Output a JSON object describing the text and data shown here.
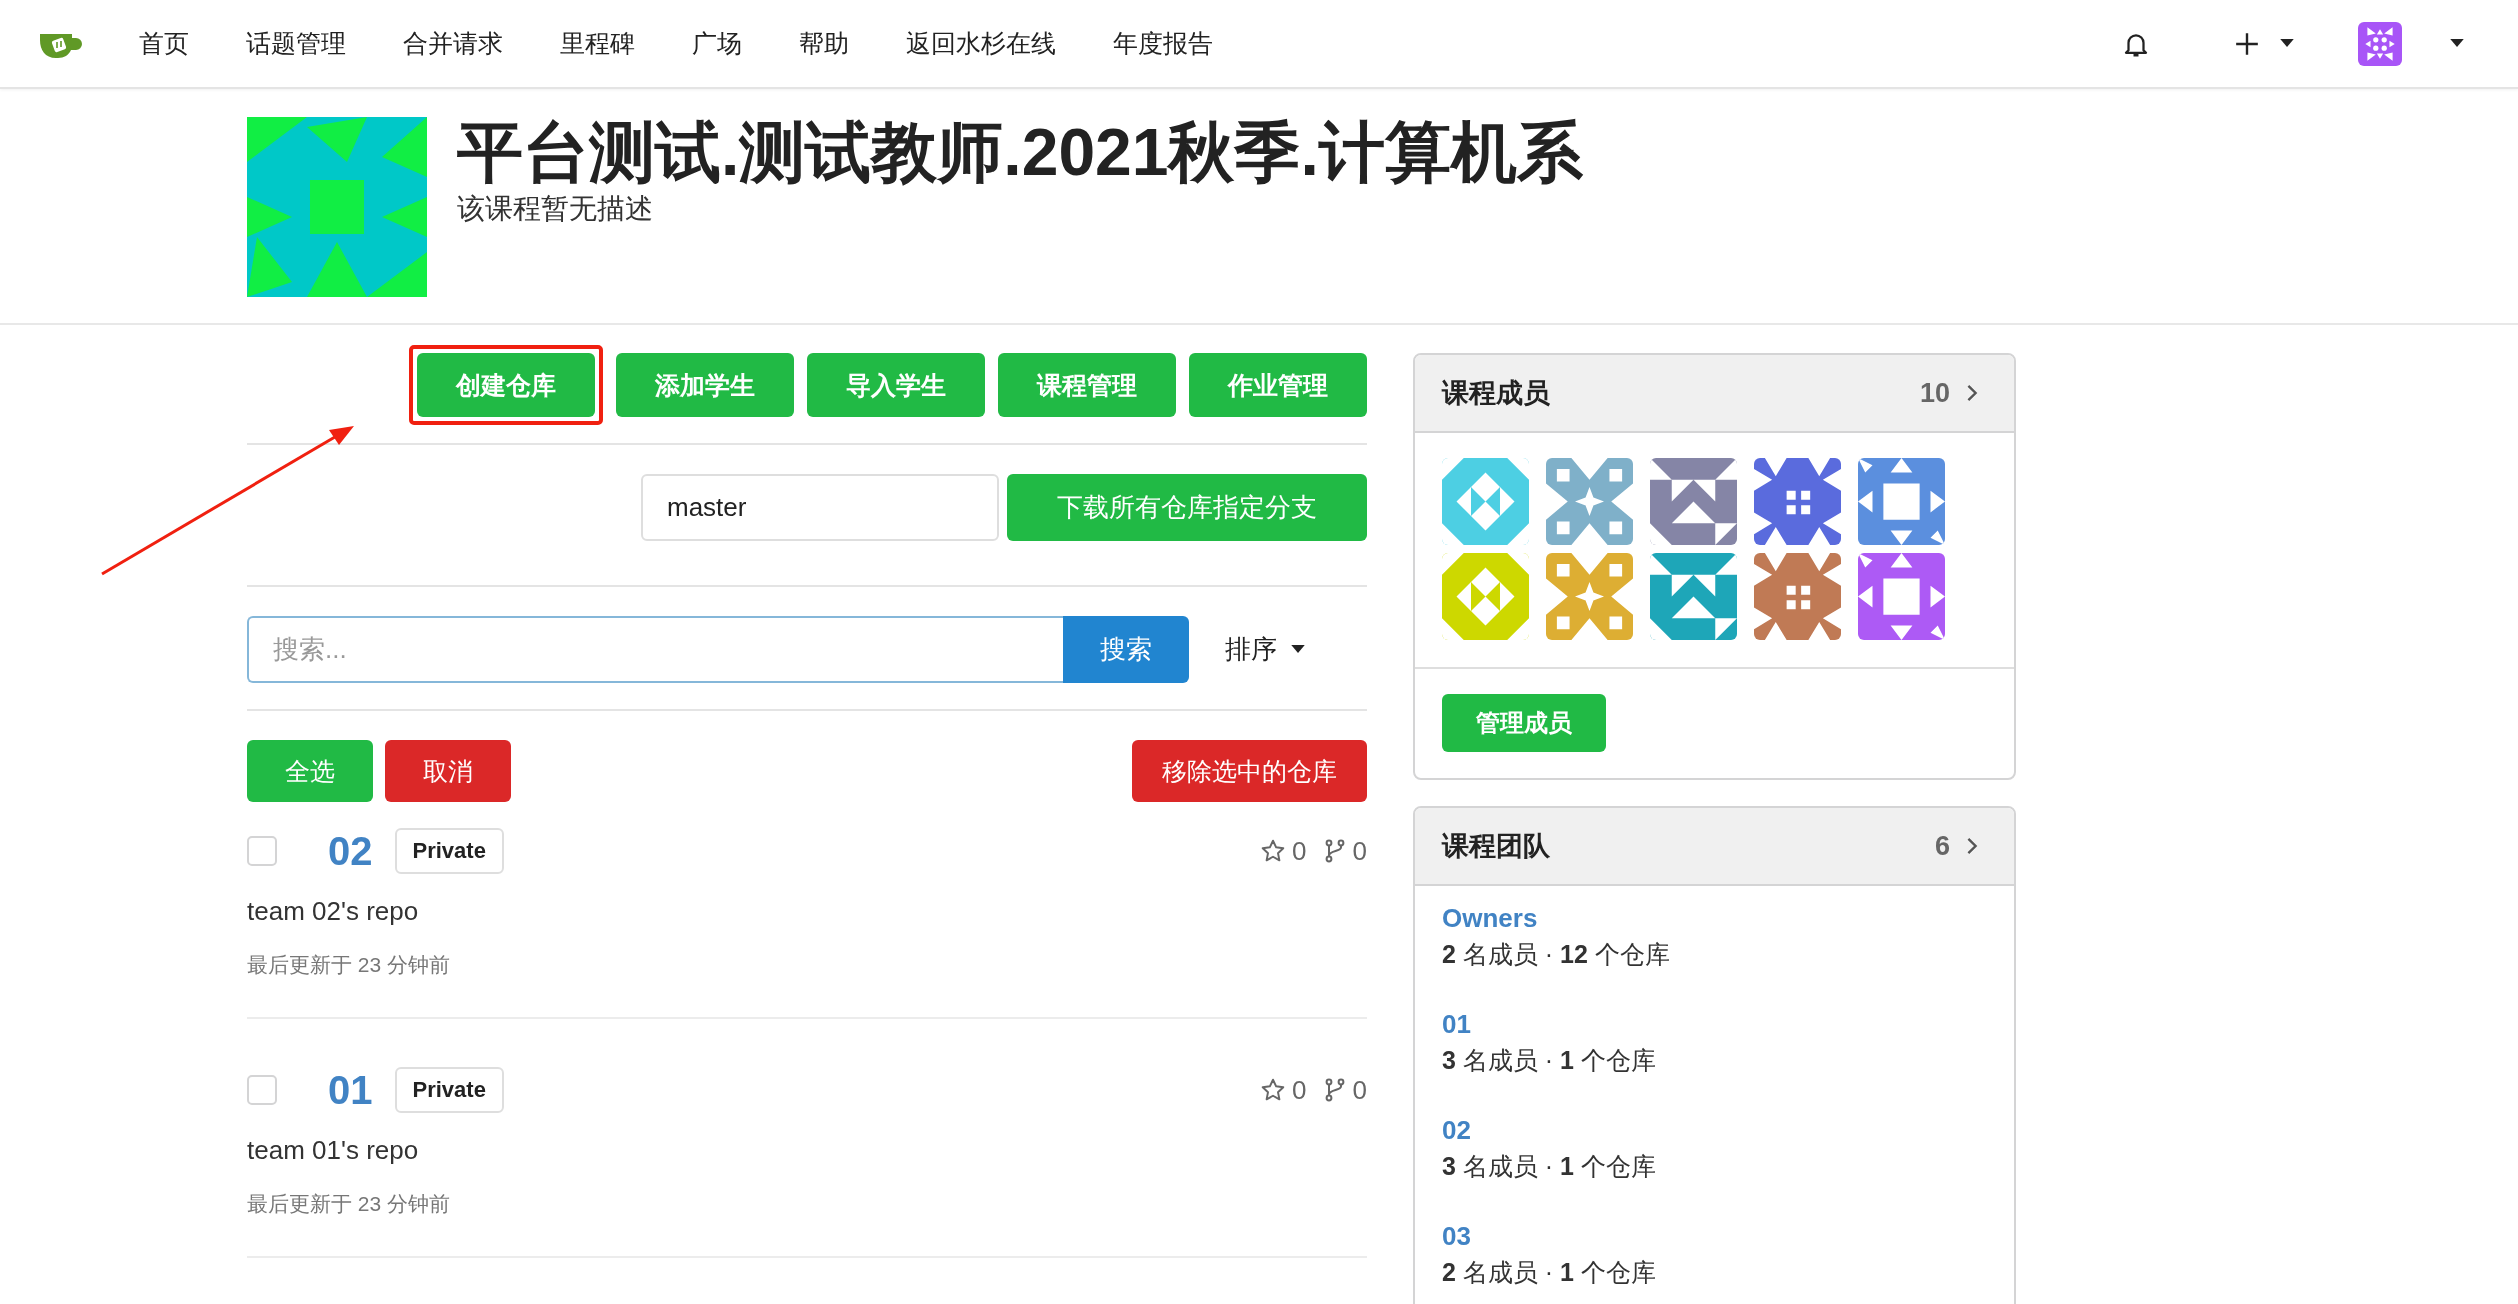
{
  "nav": {
    "items": [
      {
        "label": "首页"
      },
      {
        "label": "话题管理"
      },
      {
        "label": "合并请求"
      },
      {
        "label": "里程碑"
      },
      {
        "label": "广场"
      },
      {
        "label": "帮助"
      },
      {
        "label": "返回水杉在线"
      },
      {
        "label": "年度报告"
      }
    ]
  },
  "course": {
    "title": "平台测试.测试教师.2021秋季.计算机系",
    "description": "该课程暂无描述"
  },
  "actions": [
    {
      "label": "创建仓库",
      "annotated": true
    },
    {
      "label": "添加学生",
      "annotated": false
    },
    {
      "label": "导入学生",
      "annotated": false
    },
    {
      "label": "课程管理",
      "annotated": false
    },
    {
      "label": "作业管理",
      "annotated": false
    }
  ],
  "branch": {
    "value": "master",
    "button": "下载所有仓库指定分支"
  },
  "search": {
    "placeholder": "搜索...",
    "button": "搜索",
    "sort": "排序"
  },
  "bulk": {
    "select_all": "全选",
    "cancel": "取消",
    "remove": "移除选中的仓库"
  },
  "repos": [
    {
      "name": "02",
      "visibility": "Private",
      "checked": false,
      "star_count": "0",
      "fork_count": "0",
      "description": "team 02's repo",
      "updated": "最后更新于 23 分钟前"
    },
    {
      "name": "01",
      "visibility": "Private",
      "checked": false,
      "star_count": "0",
      "fork_count": "0",
      "description": "team 01's repo",
      "updated": "最后更新于 23 分钟前"
    }
  ],
  "members_card": {
    "title": "课程成员",
    "count": "10",
    "members": [
      {
        "color": "#4dcfe3"
      },
      {
        "color": "#7fb0c9"
      },
      {
        "color": "#8585a6"
      },
      {
        "color": "#5a6bdd"
      },
      {
        "color": "#5b8fde"
      },
      {
        "color": "#cdd800"
      },
      {
        "color": "#ddae33"
      },
      {
        "color": "#1ea6b8"
      },
      {
        "color": "#c07a55"
      },
      {
        "color": "#ad5af5"
      }
    ],
    "button": "管理成员"
  },
  "teams_card": {
    "title": "课程团队",
    "count": "6",
    "teams": [
      {
        "name": "Owners",
        "stats": "**2** 名成员 · **12** 个仓库"
      },
      {
        "name": "01",
        "stats": "**3** 名成员 · **1** 个仓库"
      },
      {
        "name": "02",
        "stats": "**3** 名成员 · **1** 个仓库"
      },
      {
        "name": "03",
        "stats": "**2** 名成员 · **1** 个仓库"
      }
    ]
  }
}
